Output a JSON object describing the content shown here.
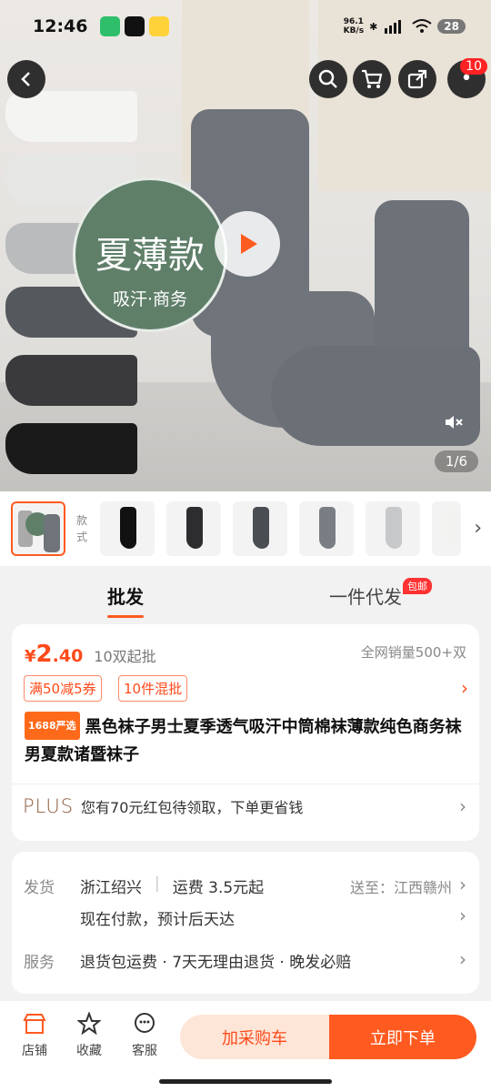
{
  "status_bar": {
    "time": "12:46",
    "net_speed_value": "96.1",
    "net_speed_unit": "KB/s",
    "battery": "28"
  },
  "hero": {
    "badge_big": "夏薄款",
    "badge_small": "吸汗·商务",
    "page_indicator": "1/6",
    "cart_badge": "10"
  },
  "thumbs": {
    "style_label": "款式"
  },
  "tabs": {
    "wholesale": "批发",
    "dropship": "一件代发",
    "dropship_badge": "包邮"
  },
  "product": {
    "currency": "¥",
    "price_int": "2",
    "price_dec": ".40",
    "min_order": "10双起批",
    "sales": "全网销量500+双",
    "promo1": "满50减5券",
    "promo2": "10件混批",
    "source_tag": "1688严选",
    "title": "黑色袜子男士夏季透气吸汗中筒棉袜薄款纯色商务袜男夏款诸暨袜子",
    "plus_logo": "PLUS",
    "plus_text": "您有70元红包待领取，下单更省钱"
  },
  "shipping": {
    "ship_label": "发货",
    "origin": "浙江绍兴",
    "fee": "运费 3.5元起",
    "dest": "送至：江西赣州",
    "eta": "现在付款，预计后天达",
    "service_label": "服务",
    "service": "退货包运费 · 7天无理由退货 · 晚发必赔"
  },
  "bottom_bar": {
    "shop": "店铺",
    "favorite": "收藏",
    "service": "客服",
    "add_cart": "加采购车",
    "buy_now": "立即下单"
  },
  "colors": {
    "accent": "#ff5a1f",
    "price": "#ff4a1a"
  }
}
